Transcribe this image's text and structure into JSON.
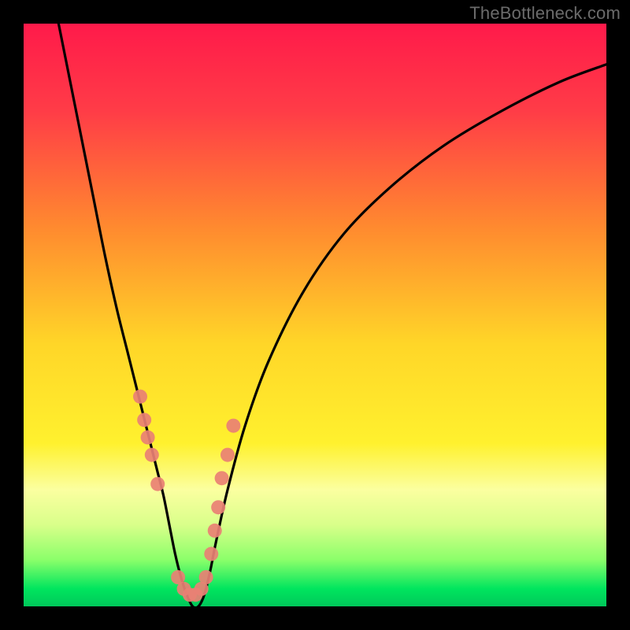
{
  "watermark": "TheBottleneck.com",
  "chart_data": {
    "type": "line",
    "title": "",
    "xlabel": "",
    "ylabel": "",
    "xlim": [
      0,
      100
    ],
    "ylim": [
      0,
      100
    ],
    "grid": false,
    "legend": "none",
    "background_gradient": {
      "stops": [
        {
          "offset": 0.0,
          "color": "#ff1a4a"
        },
        {
          "offset": 0.15,
          "color": "#ff3c47"
        },
        {
          "offset": 0.35,
          "color": "#ff8a2f"
        },
        {
          "offset": 0.55,
          "color": "#ffd628"
        },
        {
          "offset": 0.72,
          "color": "#fff12e"
        },
        {
          "offset": 0.8,
          "color": "#fbffa0"
        },
        {
          "offset": 0.86,
          "color": "#d9ff8a"
        },
        {
          "offset": 0.92,
          "color": "#8bff6a"
        },
        {
          "offset": 0.97,
          "color": "#00e55e"
        },
        {
          "offset": 1.0,
          "color": "#00c85a"
        }
      ]
    },
    "series": [
      {
        "name": "bottleneck-curve",
        "type": "line",
        "color": "#000000",
        "x": [
          6,
          8,
          10,
          12,
          14,
          16,
          18,
          20,
          21,
          22,
          23,
          24,
          25,
          26,
          27,
          28,
          29,
          30,
          31,
          32,
          33,
          35,
          38,
          42,
          48,
          55,
          63,
          72,
          82,
          92,
          100
        ],
        "y": [
          100,
          90,
          80,
          70,
          60,
          51,
          43,
          35,
          31,
          27,
          23,
          19,
          14,
          9,
          5,
          2,
          0,
          0,
          2,
          6,
          11,
          20,
          31,
          42,
          54,
          64,
          72,
          79,
          85,
          90,
          93
        ]
      },
      {
        "name": "highlight-points",
        "type": "scatter",
        "color": "#e98074",
        "radius": 9,
        "x": [
          20.0,
          20.7,
          21.3,
          22.0,
          23.0,
          26.5,
          27.5,
          28.5,
          29.5,
          30.5,
          31.3,
          32.2,
          32.8,
          33.4,
          34.0,
          35.0,
          36.0
        ],
        "y": [
          36,
          32,
          29,
          26,
          21,
          5,
          3,
          2,
          2,
          3,
          5,
          9,
          13,
          17,
          22,
          26,
          31
        ]
      }
    ]
  }
}
